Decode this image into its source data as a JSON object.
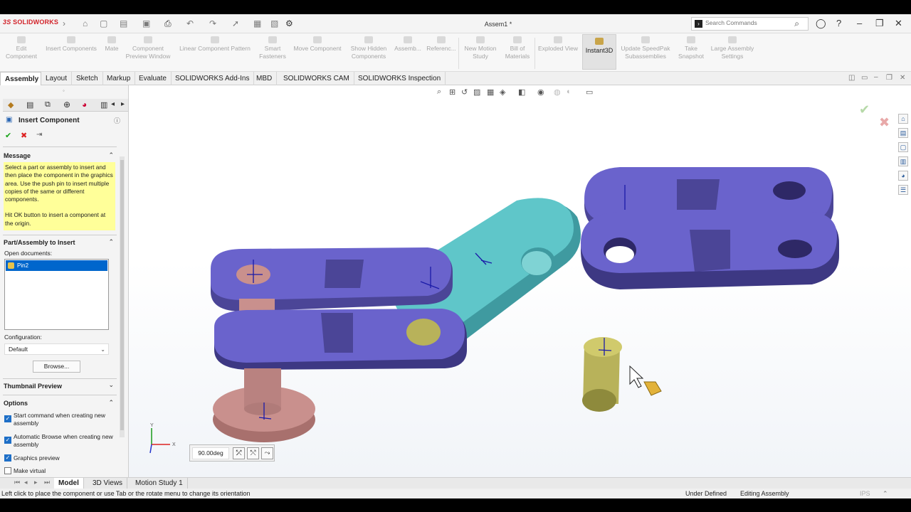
{
  "app": {
    "logo_text": "SOLIDWORKS",
    "logo_prefix": "3S",
    "doc_title": "Assem1 *",
    "search_placeholder": "Search Commands"
  },
  "ribbon": {
    "items": [
      {
        "label": "Edit\nComponent"
      },
      {
        "label": "Insert Components"
      },
      {
        "label": "Mate"
      },
      {
        "label": "Component\nPreview Window"
      },
      {
        "label": "Linear Component Pattern"
      },
      {
        "label": "Smart\nFasteners"
      },
      {
        "label": "Move Component"
      },
      {
        "label": "Show Hidden\nComponents"
      },
      {
        "label": "Assemb..."
      },
      {
        "label": "Referenc..."
      },
      {
        "label": "New Motion\nStudy"
      },
      {
        "label": "Bill of\nMaterials"
      },
      {
        "label": "Exploded View"
      },
      {
        "label": "Instant3D"
      },
      {
        "label": "Update SpeedPak\nSubassemblies"
      },
      {
        "label": "Take\nSnapshot"
      },
      {
        "label": "Large Assembly\nSettings"
      }
    ]
  },
  "tabs": [
    "Assembly",
    "Layout",
    "Sketch",
    "Markup",
    "Evaluate",
    "SOLIDWORKS Add-Ins",
    "MBD",
    "SOLIDWORKS CAM",
    "SOLIDWORKS Inspection"
  ],
  "panel": {
    "title": "Insert Component",
    "message_header": "Message",
    "message_text_1": "Select a part or assembly to insert and then place the component in the graphics area. Use the push pin to insert multiple copies of the same or different components.",
    "message_text_2": "Hit OK button to insert a component at the origin.",
    "part_header": "Part/Assembly to Insert",
    "open_docs_label": "Open documents:",
    "open_docs": [
      "Pin2"
    ],
    "config_label": "Configuration:",
    "config_value": "Default",
    "browse_label": "Browse...",
    "thumbnail_header": "Thumbnail Preview",
    "options_header": "Options",
    "options": [
      {
        "label": "Start command when creating new assembly",
        "checked": true
      },
      {
        "label": "Automatic Browse when creating new assembly",
        "checked": true
      },
      {
        "label": "Graphics preview",
        "checked": true
      },
      {
        "label": "Make virtual",
        "checked": false
      }
    ]
  },
  "rotate": {
    "angle": "90.00deg"
  },
  "bottom_tabs": [
    "Model",
    "3D Views",
    "Motion Study 1"
  ],
  "status": {
    "hint": "Left click to place the component or use Tab or the rotate menu to change its orientation",
    "state1": "Under Defined",
    "state2": "Editing Assembly",
    "units": "IPS"
  },
  "colors": {
    "link_body": "#6a63cc",
    "link_body_dark": "#4b4597",
    "link_teal": "#5fc6c9",
    "pin_pink": "#c9908d",
    "pin_yellow": "#b8b25a",
    "selection_blue": "#0066cc",
    "message_bg": "#ffff99"
  }
}
